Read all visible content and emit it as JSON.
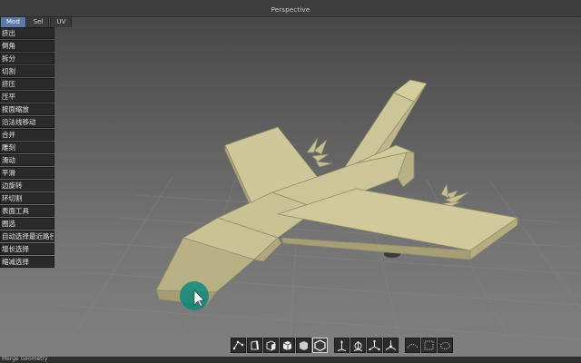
{
  "viewport": {
    "title": "Perspective"
  },
  "tabs": [
    {
      "label": "Mod",
      "active": true
    },
    {
      "label": "Sel",
      "active": false
    },
    {
      "label": "UV",
      "active": false
    }
  ],
  "tools": [
    "挤出",
    "倒角",
    "拆分",
    "切割",
    "挤压",
    "压平",
    "按面缩放",
    "沿法线移动",
    "合并",
    "雕刻",
    "滑动",
    "平滑",
    "边旋转",
    "环切割",
    "表面工具"
  ],
  "select_tools": [
    "圈选",
    "自动选择最近路径",
    "增长选择",
    "缩减选择"
  ],
  "toolbar": {
    "mode_buttons": [
      "vertex-mode-icon",
      "edge-mode-icon",
      "face-mode-icon",
      "object-mode-icon",
      "solid-mode-icon",
      "wireframe-toggle-icon"
    ],
    "axis_buttons": [
      "move-axis-icon",
      "rotate-axis-icon",
      "scale-axis-icon",
      "universal-axis-icon"
    ],
    "display_buttons": [
      "smooth-display-icon",
      "grid-display-icon",
      "cloud-display-icon"
    ],
    "active_index": 5
  },
  "status": {
    "text": "Merge Geometry"
  },
  "colors": {
    "model": "#cbc597",
    "model_shadow": "#a9a27a",
    "panel_bg": "#2a2a2a",
    "active_tab": "#5a7aa8",
    "cursor_highlight": "#0e8a7a"
  }
}
